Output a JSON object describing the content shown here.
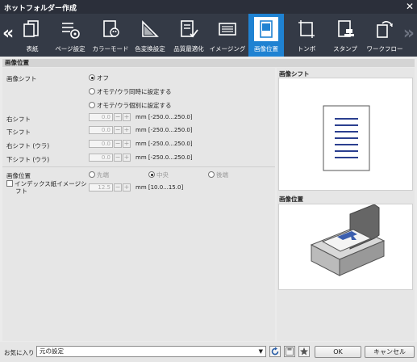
{
  "window": {
    "title": "ホットフォルダー作成",
    "close_label": "✕"
  },
  "toolbar": {
    "prev_label": "«",
    "next_label": "»",
    "items": [
      {
        "label": "表紙",
        "icon": "cover-icon"
      },
      {
        "label": "ページ設定",
        "icon": "page-setup-icon"
      },
      {
        "label": "カラーモード",
        "icon": "color-mode-icon"
      },
      {
        "label": "色変換設定",
        "icon": "color-conversion-icon"
      },
      {
        "label": "品質最適化",
        "icon": "quality-icon"
      },
      {
        "label": "イメージング",
        "icon": "imaging-icon"
      },
      {
        "label": "画像位置",
        "icon": "image-position-icon",
        "active": true
      },
      {
        "label": "トンボ",
        "icon": "crop-marks-icon"
      },
      {
        "label": "スタンプ",
        "icon": "stamp-icon"
      },
      {
        "label": "ワークフロー",
        "icon": "workflow-icon"
      }
    ]
  },
  "section": {
    "title": "画像位置"
  },
  "image_shift": {
    "label": "画像シフト",
    "options": [
      "オフ",
      "オモテ/ウラ同時に設定する",
      "オモテ/ウラ個別に設定する"
    ],
    "selected": "オフ"
  },
  "shifts": [
    {
      "label": "右シフト",
      "value": "0.0",
      "minus": "−",
      "plus": "+",
      "range": "mm [-250.0...250.0]"
    },
    {
      "label": "下シフト",
      "value": "0.0",
      "minus": "−",
      "plus": "+",
      "range": "mm [-250.0...250.0]"
    },
    {
      "label": "右シフト (ウラ)",
      "value": "0.0",
      "minus": "−",
      "plus": "+",
      "range": "mm [-250.0...250.0]"
    },
    {
      "label": "下シフト (ウラ)",
      "value": "0.0",
      "minus": "−",
      "plus": "+",
      "range": "mm [-250.0...250.0]"
    }
  ],
  "image_position": {
    "label": "画像位置",
    "options": [
      "先端",
      "中央",
      "後端"
    ],
    "selected": "中央"
  },
  "index_shift": {
    "label_line1": "インデックス紙イメージシ",
    "label_line2": "フト",
    "value": "12.5",
    "minus": "−",
    "plus": "+",
    "range": "mm [10.0...15.0]"
  },
  "previews": {
    "shift_title": "画像シフト",
    "position_title": "画像位置"
  },
  "bottom": {
    "favorites_label": "お気に入り",
    "favorites_value": "元の設定",
    "ok_label": "OK",
    "cancel_label": "キャンセル"
  }
}
